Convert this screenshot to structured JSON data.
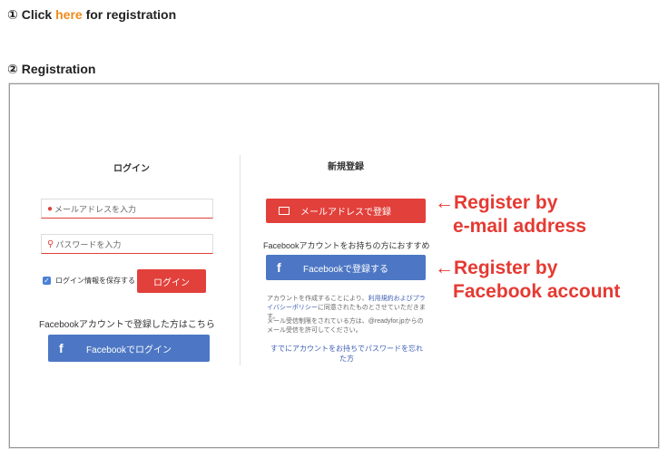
{
  "step1": {
    "prefix": "① Click ",
    "link": "here",
    "suffix": " for registration"
  },
  "step2": {
    "label": "② Registration"
  },
  "login": {
    "title": "ログイン",
    "email_placeholder": "メールアドレスを入力",
    "password_placeholder": "パスワードを入力",
    "remember_label": "ログイン情報を保存する",
    "login_button": "ログイン",
    "facebook_note": "Facebookアカウントで登録した方はこちら",
    "facebook_login_button": "Facebookでログイン"
  },
  "signup": {
    "title": "新規登録",
    "email_button": "メールアドレスで登録",
    "facebook_recommend": "Facebookアカウントをお持ちの方におすすめ",
    "facebook_button": "Facebookで登録する",
    "terms_1": "アカウントを作成することにより、",
    "terms_link": "利用規約およびプライバシーポリシー",
    "terms_2": "に同意されたものとさせていただきます。",
    "mail_note": "メール受信制限をされている方は、@readyfor.jpからのメール受信を許可してください。",
    "already_link": "すでにアカウントをお持ちでパスワードを忘れた方"
  },
  "annotations": {
    "email_line1": "←Register by",
    "email_line2": "e-mail address",
    "facebook_line1": "←Register by",
    "facebook_line2": "Facebook account"
  },
  "colors": {
    "accent_orange": "#f08a1c",
    "red": "#e2403b",
    "facebook_blue": "#4d77c4",
    "annotation_red": "#e53a32"
  }
}
